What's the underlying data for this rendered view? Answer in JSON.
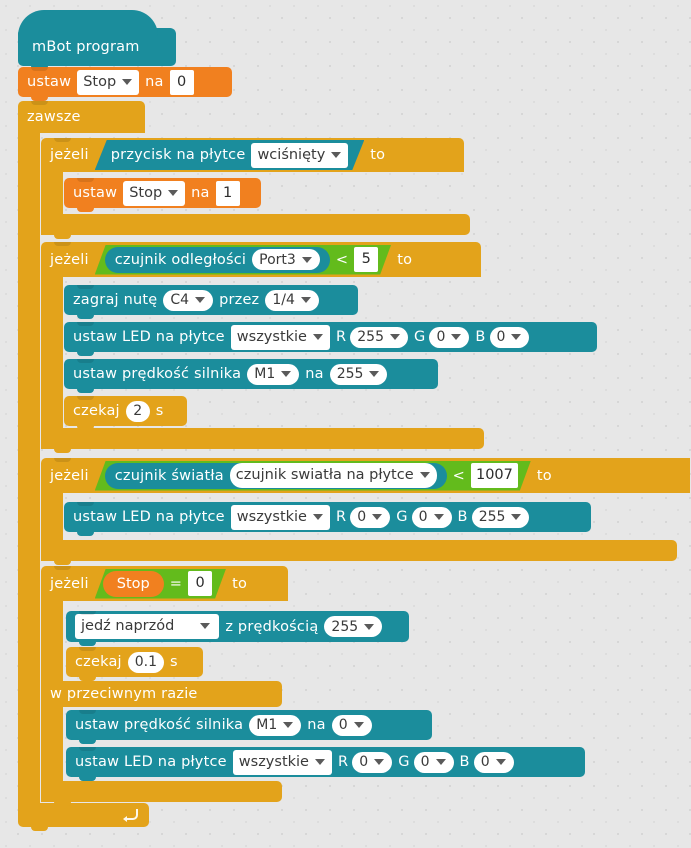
{
  "program": {
    "title": "mBot program",
    "colors": {
      "hat": "#1b8d9c",
      "data": "#f1801f",
      "control": "#e3a31b",
      "robot": "#1b8d9c",
      "operator": "#63bb1c",
      "background": "#e7e7e7",
      "field_text": "#3a3a3a"
    },
    "blocks": {
      "set_var": {
        "label": "ustaw",
        "to": "na",
        "variable": "Stop",
        "value_initial": "0",
        "value_pressed": "1"
      },
      "forever": {
        "label": "zawsze"
      },
      "if": {
        "label": "jeżeli",
        "then": "to"
      },
      "else": {
        "label": "w przeciwnym razie"
      },
      "button_sensor": {
        "prefix": "przycisk na płytce",
        "state": "wciśnięty"
      },
      "distance_sensor": {
        "prefix": "czujnik odległości",
        "port": "Port3",
        "operator": "<",
        "threshold": "5"
      },
      "light_sensor": {
        "prefix": "czujnik światła",
        "source": "czujnik swiatła na płytce",
        "operator": "<",
        "threshold": "1007"
      },
      "play_note": {
        "prefix": "zagraj nutę",
        "note": "C4",
        "middle": "przez",
        "beat": "1/4"
      },
      "led_red": {
        "prefix": "ustaw LED na płytce",
        "which": "wszystkie",
        "r_label": "R",
        "r": "255",
        "g_label": "G",
        "g": "0",
        "b_label": "B",
        "b": "0"
      },
      "led_blue": {
        "prefix": "ustaw LED na płytce",
        "which": "wszystkie",
        "r_label": "R",
        "r": "0",
        "g_label": "G",
        "g": "0",
        "b_label": "B",
        "b": "255"
      },
      "led_off": {
        "prefix": "ustaw LED na płytce",
        "which": "wszystkie",
        "r_label": "R",
        "r": "0",
        "g_label": "G",
        "g": "0",
        "b_label": "B",
        "b": "0"
      },
      "motor_full": {
        "prefix": "ustaw prędkość silnika",
        "port": "M1",
        "to": "na",
        "speed": "255"
      },
      "motor_stop": {
        "prefix": "ustaw prędkość silnika",
        "port": "M1",
        "to": "na",
        "speed": "0"
      },
      "wait_2": {
        "label": "czekaj",
        "value": "2",
        "unit": "s"
      },
      "wait_01": {
        "label": "czekaj",
        "value": "0.1",
        "unit": "s"
      },
      "drive": {
        "direction": "jedź naprzód",
        "middle": "z prędkością",
        "speed": "255"
      },
      "compare_var": {
        "variable": "Stop",
        "operator": "=",
        "value": "0"
      }
    },
    "icons": {
      "loop_arrow": "loop-arrow-icon",
      "dropdown": "chevron-down-icon"
    }
  }
}
